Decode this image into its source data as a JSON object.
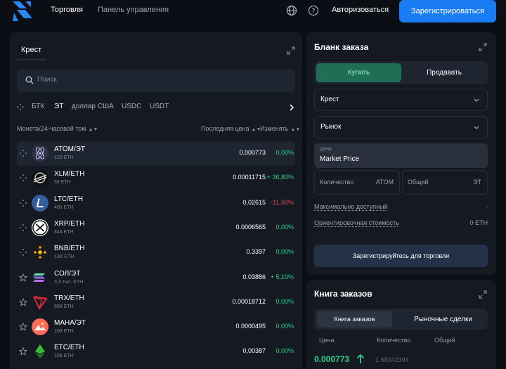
{
  "nav": {
    "trade": "Торговля",
    "dashboard": "Панель управления",
    "login": "Авторизоваться",
    "signup": "Зарегистрироваться"
  },
  "market": {
    "tab": "Крест",
    "search_placeholder": "Поиск",
    "filters": [
      "БТК",
      "ЭТ",
      "доллар США",
      "USDC",
      "USDT"
    ],
    "active_filter": "ЭТ",
    "columns": {
      "coin": "Монета/24-часовой том",
      "price": "Последняя цена",
      "change": "Изменять"
    },
    "rows": [
      {
        "pair": "ATOM/ЭТ",
        "vol": "120 ETH",
        "price": "0.000773",
        "change": "0,00%",
        "dir": "pos",
        "icon": "atom-coin-icon",
        "color": "#2e3148"
      },
      {
        "pair": "XLM/ETH",
        "vol": "59 ETH",
        "price": "0.00011715",
        "change": "+ 36,80%",
        "dir": "pos",
        "icon": "stellar-coin-icon",
        "color": "#111111"
      },
      {
        "pair": "LTC/ETH",
        "vol": "405 ETH",
        "price": "0,02615",
        "change": "-11,50%",
        "dir": "neg",
        "icon": "litecoin-coin-icon",
        "color": "#345d9d"
      },
      {
        "pair": "XRP/ETH",
        "vol": "844 ETH",
        "price": "0.0006565",
        "change": "0,00%",
        "dir": "pos",
        "icon": "xrp-coin-icon",
        "color": "#ffffff"
      },
      {
        "pair": "BNB/ETH",
        "vol": "13K ETH",
        "price": "0.3397",
        "change": "0,00%",
        "dir": "pos",
        "icon": "bnb-coin-icon",
        "color": "#1a1a1a"
      },
      {
        "pair": "СОЛ/ЭТ",
        "vol": "3,3 тыс. ETH",
        "price": "0.03886",
        "change": "+ 5,10%",
        "dir": "pos",
        "icon": "solana-coin-icon",
        "color": "#151a22"
      },
      {
        "pair": "TRX/ETH",
        "vol": "598 ETH",
        "price": "0.00018712",
        "change": "0,00%",
        "dir": "pos",
        "icon": "tron-coin-icon",
        "color": "#151a22"
      },
      {
        "pair": "МАНА/ЭТ",
        "vol": "208 ETH",
        "price": "0.0000495",
        "change": "0,00%",
        "dir": "pos",
        "icon": "mana-coin-icon",
        "color": "#ff5b5b"
      },
      {
        "pair": "ETC/ETH",
        "vol": "108 ETH",
        "price": "0,00387",
        "change": "0,00%",
        "dir": "pos",
        "icon": "etc-coin-icon",
        "color": "#151a22"
      }
    ]
  },
  "order": {
    "title": "Бланк заказа",
    "buy": "Купить",
    "sell": "Продавать",
    "select1": "Крест",
    "select2": "Рынок",
    "price_caption": "Цена",
    "price_value": "Market Price",
    "qty_label": "Количество",
    "qty_unit": "ATOM",
    "total_label": "Общий",
    "total_unit": "ЭТ",
    "max_label": "Максимально доступный",
    "max_value": "-",
    "est_label": "Ориентировочная стоимость",
    "est_value": "0 ETH",
    "register_btn": "Зарегистрируйтесь для торговли"
  },
  "book": {
    "title": "Книга заказов",
    "tab_book": "Книга заказов",
    "tab_trades": "Рыночные сделки",
    "col_price": "Цена",
    "col_qty": "Количество",
    "col_total": "Общий",
    "last_price": "0.000773",
    "last_qty": "1.68342394"
  },
  "colors": {
    "accent": "#1a7cf2",
    "positive": "#2fcf8a",
    "negative": "#e0475a",
    "panel": "#151a22",
    "background": "#0b0e14"
  }
}
